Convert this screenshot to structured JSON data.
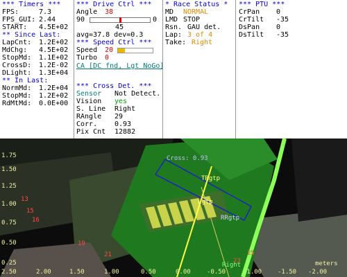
{
  "timers": {
    "header": "*** Timers ***",
    "fps_label": "FPS:",
    "fps_value": "7.3",
    "fps_gui_label": "FPS_GUI:",
    "fps_gui_value": "2.44",
    "start_label": "START:",
    "start_value": "4.5E+02",
    "since_header": "** Since Last:",
    "lapcnt_label": "LapCnt:",
    "lapcnt_value": "1.2E+02",
    "mdchg_label": "MdChg:",
    "mdchg_value": "4.5E+02",
    "stopmd_label": "StopMd:",
    "stopmd_value": "1.1E+02",
    "crossd_label": "CrossD:",
    "crossd_value": "1.2E-02",
    "dlight_label": "DLight:",
    "dlight_value": "1.3E+04",
    "in_header": "** In Last:",
    "normmd_label": "NormMd:",
    "normmd_value": "1.2E+04",
    "stopmd2_label": "StopMd:",
    "stopmd2_value": "1.2E+02",
    "rdmtmd_label": "RdMtMd:",
    "rdmtmd_value": "0.0E+00"
  },
  "drive": {
    "header": "***  Drive Ctrl  ***",
    "angle_label": "Angle",
    "angle_value": "38",
    "range_min": "90",
    "range_max": "0",
    "slider_value": "45",
    "slider_level": 0.5,
    "avg_line": "avg=37.8  dev=0.3",
    "speed_header": "***  Speed Ctrl  ***",
    "speed_label": "Speed",
    "speed_value": "20",
    "speed_level": 0.2,
    "turbo_label": "Turbo",
    "turbo_value": "0",
    "ca_line": "CA [DC fnd, Lgt NoGo]",
    "cross_header": "*** Cross Det. ***",
    "sensor_label": "Sensor",
    "sensor_value": "Not Detect.",
    "vision_label": "Vision",
    "vision_value": "yes",
    "sline_label": "S. Line",
    "sline_value": "Right",
    "rangle_label": "RAngle",
    "rangle_value": "29",
    "corr_label": "Corr.",
    "corr_value": "0.93",
    "pix_label": "Pix Cnt",
    "pix_value": "12882"
  },
  "race": {
    "header": "* Race Status *",
    "md_label": "MD",
    "md_value": "NORMAL",
    "lmd_label": "LMD",
    "lmd_value": "STOP",
    "rsn_label": "Rsn.",
    "rsn_value": "GAU det.",
    "lap_label": "Lap:",
    "lap_value": "3 of 4",
    "take_label": "Take:",
    "take_value": "Right"
  },
  "ptu": {
    "header": "*** PTU ***",
    "crpan_label": "CrPan",
    "crpan_value": "0",
    "crtilt_label": "CrTilt",
    "crtilt_value": "-35",
    "dspan_label": "DsPan",
    "dspan_value": "0",
    "dstilt_label": "DsTilt",
    "dstilt_value": "-35"
  },
  "camera": {
    "y_ticks": [
      "1.75",
      "1.50",
      "1.25",
      "1.00",
      "0.75",
      "0.50",
      "0.25"
    ],
    "x_ticks": [
      "2.50",
      "2.00",
      "1.50",
      "1.00",
      "0.50",
      "0.00",
      "-0.50",
      "-1.00",
      "-1.50",
      "-2.00"
    ],
    "units": "meters",
    "cross_label": "Cross: 0.93",
    "trgtp_label": "TRgtp",
    "lgtp_label": "Lgtp",
    "rrgtp_label": "RRgtp",
    "right_label": "Right",
    "markers": [
      "13",
      "15",
      "16",
      "19",
      "21",
      "25",
      "23"
    ]
  }
}
